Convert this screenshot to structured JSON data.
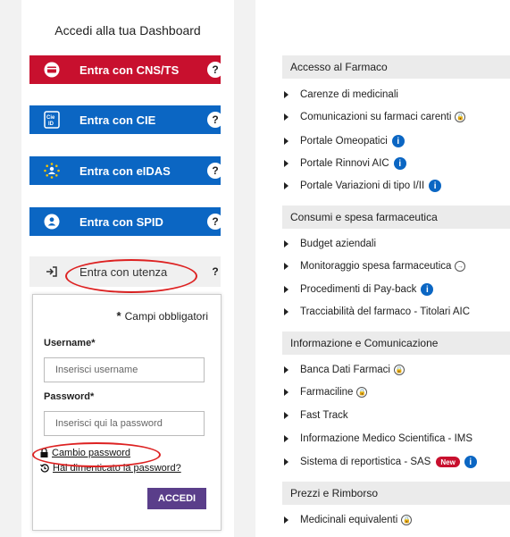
{
  "login": {
    "title": "Accedi alla tua Dashboard",
    "buttons": {
      "cns": "Entra con CNS/TS",
      "cie": "Entra con CIE",
      "eidas": "Entra con eIDAS",
      "spid": "Entra con SPID",
      "user": "Entra con utenza"
    },
    "help_symbol": "?",
    "cie_icon_text": "CIE\nID",
    "form": {
      "required_note": "Campi obbligatori",
      "username_label": "Username",
      "username_placeholder": "Inserisci username",
      "password_label": "Password",
      "password_placeholder": "Inserisci qui la password",
      "change_password": "Cambio password",
      "forgot_password": "Hai dimenticato la password?",
      "submit": "ACCEDI"
    }
  },
  "sections": [
    {
      "title": "Accesso al Farmaco",
      "items": [
        {
          "label": "Carenze di medicinali"
        },
        {
          "label": "Comunicazioni su farmaci carenti",
          "icon": "lock"
        },
        {
          "label": "Portale Omeopatici",
          "icon": "info"
        },
        {
          "label": "Portale Rinnovi AIC",
          "icon": "info"
        },
        {
          "label": "Portale Variazioni di tipo I/II",
          "icon": "info"
        }
      ]
    },
    {
      "title": "Consumi e spesa farmaceutica",
      "items": [
        {
          "label": "Budget aziendali"
        },
        {
          "label": "Monitoraggio spesa farmaceutica",
          "icon": "login"
        },
        {
          "label": "Procedimenti di Pay-back",
          "icon": "info"
        },
        {
          "label": "Tracciabilità del farmaco - Titolari AIC"
        }
      ]
    },
    {
      "title": "Informazione e Comunicazione",
      "items": [
        {
          "label": "Banca Dati Farmaci",
          "icon": "lock"
        },
        {
          "label": "Farmaciline",
          "icon": "lock"
        },
        {
          "label": "Fast Track"
        },
        {
          "label": "Informazione Medico Scientifica - IMS"
        },
        {
          "label": "Sistema di reportistica - SAS",
          "badge": "New",
          "icon": "info"
        }
      ]
    },
    {
      "title": "Prezzi e Rimborso",
      "items": [
        {
          "label": "Medicinali equivalenti",
          "icon": "lock"
        }
      ]
    }
  ],
  "colors": {
    "red": "#c8102e",
    "blue": "#0b66c3",
    "purple": "#5a3e8a"
  }
}
